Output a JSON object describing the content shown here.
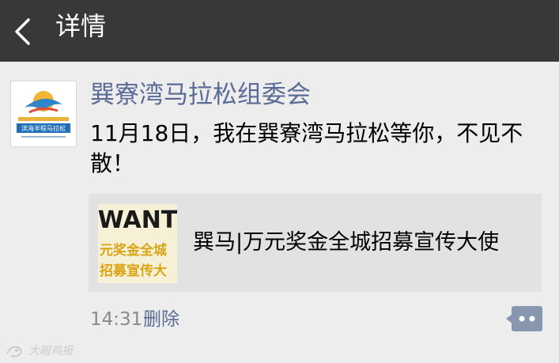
{
  "header": {
    "title": "详情",
    "back_icon": "chevron-left-icon"
  },
  "post": {
    "sender_name": "巽寮湾马拉松组委会",
    "avatar_text": "滨海半程马拉松",
    "text": "11月18日，我在巽寮湾马拉松等你，不见不散！",
    "link": {
      "thumb_text_line1": "WANT",
      "thumb_text_line2": "元奖金全城",
      "thumb_text_line3": "招募宣传大",
      "title": "巽马|万元奖金全城招募宣传大使"
    },
    "time": "14:31",
    "delete_label": "删除",
    "comment_icon": "comment-dots-icon"
  },
  "watermark": {
    "text": "大眼鸡报"
  },
  "colors": {
    "header_bg": "#383838",
    "page_bg": "#ededed",
    "link_blue": "#5a6c95",
    "card_bg": "#e2e2e2",
    "comment_btn": "#8797ad"
  }
}
